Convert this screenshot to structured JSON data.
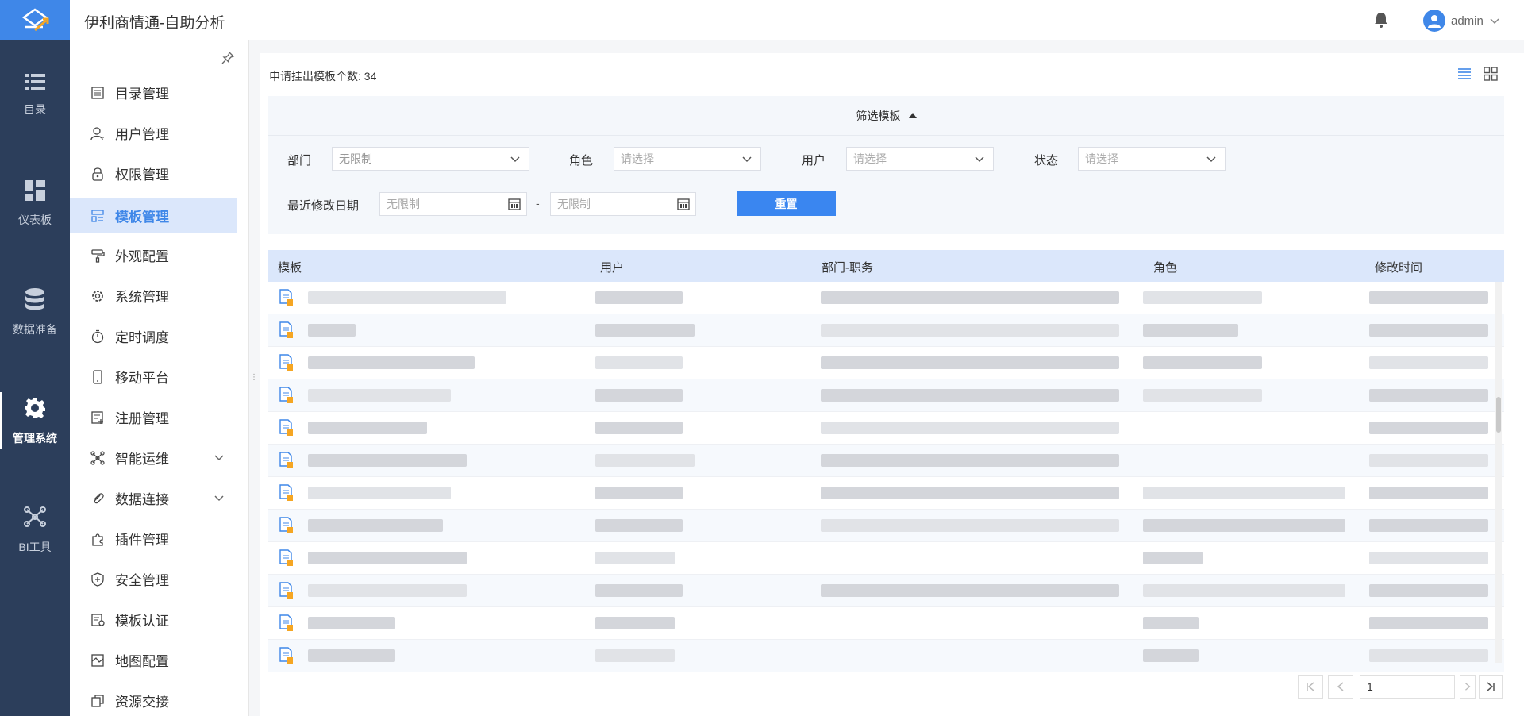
{
  "header": {
    "title": "伊利商情通-自助分析",
    "user": "admin"
  },
  "rail": [
    {
      "label": "目录",
      "icon": "list-icon"
    },
    {
      "label": "仪表板",
      "icon": "dashboard-icon"
    },
    {
      "label": "数据准备",
      "icon": "database-icon"
    },
    {
      "label": "管理系统",
      "icon": "gear-icon",
      "active": true
    },
    {
      "label": "BI工具",
      "icon": "network-icon"
    }
  ],
  "sidebar": {
    "items": [
      {
        "label": "目录管理"
      },
      {
        "label": "用户管理"
      },
      {
        "label": "权限管理"
      },
      {
        "label": "模板管理",
        "active": true
      },
      {
        "label": "外观配置"
      },
      {
        "label": "系统管理"
      },
      {
        "label": "定时调度"
      },
      {
        "label": "移动平台"
      },
      {
        "label": "注册管理"
      },
      {
        "label": "智能运维"
      },
      {
        "label": "数据连接"
      },
      {
        "label": "插件管理"
      },
      {
        "label": "安全管理"
      },
      {
        "label": "模板认证"
      },
      {
        "label": "地图配置"
      },
      {
        "label": "资源交接"
      }
    ]
  },
  "main": {
    "count_text": "申请挂出模板个数: 34",
    "filter_title": "筛选模板",
    "filters": {
      "dept_label": "部门",
      "dept_value": "无限制",
      "role_label": "角色",
      "role_placeholder": "请选择",
      "user_label": "用户",
      "user_placeholder": "请选择",
      "status_label": "状态",
      "status_placeholder": "请选择",
      "date_label": "最近修改日期",
      "date_from": "无限制",
      "date_sep": "-",
      "date_to": "无限制",
      "reset_label": "重置"
    },
    "table": {
      "columns": [
        "模板",
        "用户",
        "部门-职务",
        "角色",
        "修改时间"
      ]
    },
    "pager": {
      "page": "1"
    }
  },
  "colors": {
    "accent": "#3f87e8",
    "rail_bg": "#2c3e5b",
    "active_bg": "#dbe7fb"
  }
}
